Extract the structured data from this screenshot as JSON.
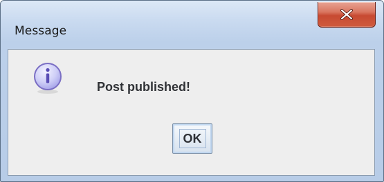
{
  "window": {
    "title": "Message"
  },
  "dialog": {
    "message": "Post published!",
    "ok_label": "OK",
    "icon": "info-icon"
  },
  "colors": {
    "close_button": "#c74a32",
    "icon_fill": "#c9c9f5",
    "icon_border": "#7b6fc4",
    "text": "#303236"
  }
}
